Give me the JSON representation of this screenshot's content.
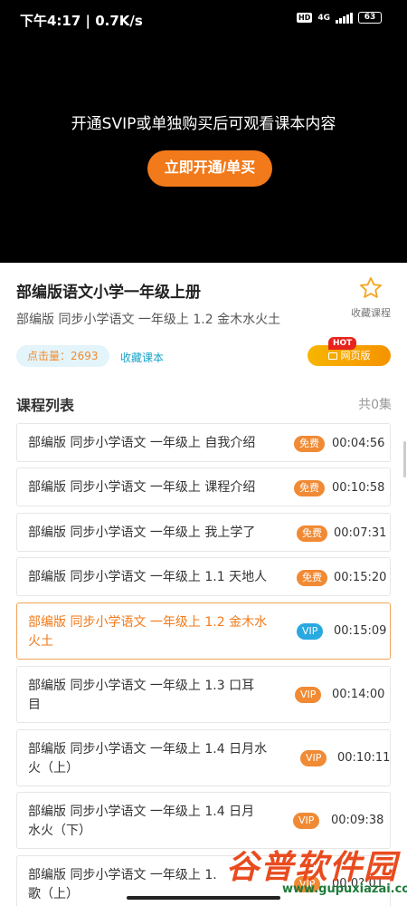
{
  "status": {
    "time": "下午4:17 | 0.7K/s",
    "hd": "HD",
    "network": "4G",
    "battery": "63"
  },
  "player": {
    "message": "开通SVIP或单独购买后可观看课本内容",
    "button": "立即开通/单买"
  },
  "course": {
    "title": "部编版语文小学一年级上册",
    "subtitle": "部编版 同步小学语文 一年级上 1.2 金木水火土",
    "favorite_label": "收藏课程",
    "clicks": "点击量：2693",
    "favorite_book": "收藏课本",
    "web_version": "网页版",
    "hot": "HOT"
  },
  "list": {
    "title": "课程列表",
    "count": "共0集",
    "items": [
      {
        "line1": "部编版 同步小学语文 一年级上 自我介绍",
        "line2": "",
        "badge": "免费",
        "duration": "00:04:56"
      },
      {
        "line1": "部编版 同步小学语文 一年级上 课程介绍",
        "line2": "",
        "badge": "免费",
        "duration": "00:10:58"
      },
      {
        "line1": "部编版 同步小学语文 一年级上 我上学了",
        "line2": "",
        "badge": "免费",
        "duration": "00:07:31"
      },
      {
        "line1": "部编版 同步小学语文 一年级上 1.1 天地人",
        "line2": "",
        "badge": "免费",
        "duration": "00:15:20"
      },
      {
        "line1": "部编版 同步小学语文 一年级上 1.2 金木水",
        "line2": "火土",
        "badge": "VIP",
        "duration": "00:15:09"
      },
      {
        "line1": "部编版 同步小学语文 一年级上 1.3 口耳",
        "line2": "目",
        "badge": "VIP",
        "duration": "00:14:00"
      },
      {
        "line1": "部编版 同步小学语文 一年级上 1.4 日月水",
        "line2": "火（上）",
        "badge": "VIP",
        "duration": "00:10:11"
      },
      {
        "line1": "部编版 同步小学语文 一年级上 1.4 日月",
        "line2": "水火（下）",
        "badge": "VIP",
        "duration": "00:09:38"
      },
      {
        "line1": "部编版 同步小学语文 一年级上 1.",
        "line2": "歌（上）",
        "badge": "VIP",
        "duration": "00:0?:01"
      }
    ]
  },
  "watermark": {
    "cn": "谷普软件园",
    "url": "www.gupuxiazai.com"
  },
  "colors": {
    "accent": "#f27a1a",
    "vip": "#2aa8e0",
    "link": "#1aa3c8"
  }
}
